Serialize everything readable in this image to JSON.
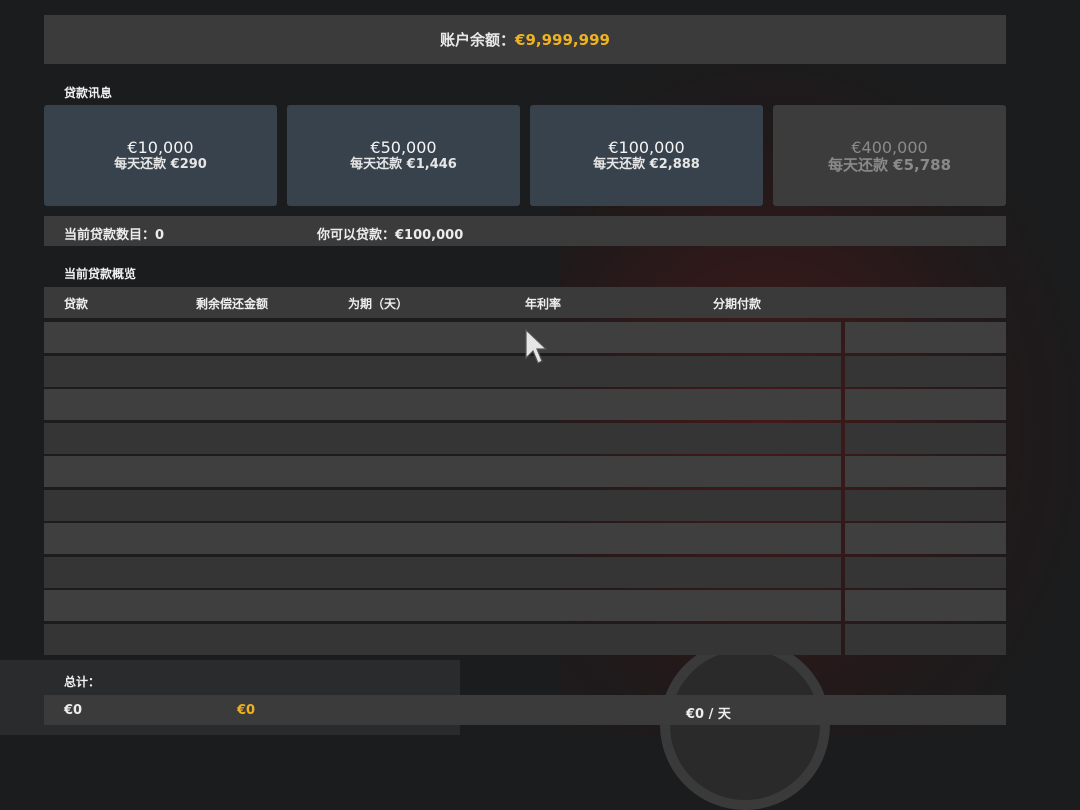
{
  "balance": {
    "label": "账户余额：",
    "value": "€9,999,999"
  },
  "loan_info": {
    "title": "贷款讯息",
    "offers": [
      {
        "amount": "€10,000",
        "daily": "每天还款 €290",
        "enabled": true
      },
      {
        "amount": "€50,000",
        "daily": "每天还款 €1,446",
        "enabled": true
      },
      {
        "amount": "€100,000",
        "daily": "每天还款 €2,888",
        "enabled": true
      },
      {
        "amount": "€400,000",
        "daily": "每天还款 €5,788",
        "enabled": false
      }
    ]
  },
  "status": {
    "current_loans": "当前贷款数目：0",
    "can_borrow": "你可以贷款：€100,000"
  },
  "overview": {
    "title": "当前贷款概览",
    "columns": [
      "贷款",
      "剩余偿还金额",
      "为期（天）",
      "年利率",
      "分期付款"
    ],
    "rows": 10
  },
  "totals": {
    "label": "总计：",
    "loan": "€0",
    "remaining": "€0",
    "installment": "€0 / 天"
  },
  "colors": {
    "accent": "#f0b320",
    "offer_bg": "#38424c",
    "panel_bg": "#3b3b3b"
  }
}
